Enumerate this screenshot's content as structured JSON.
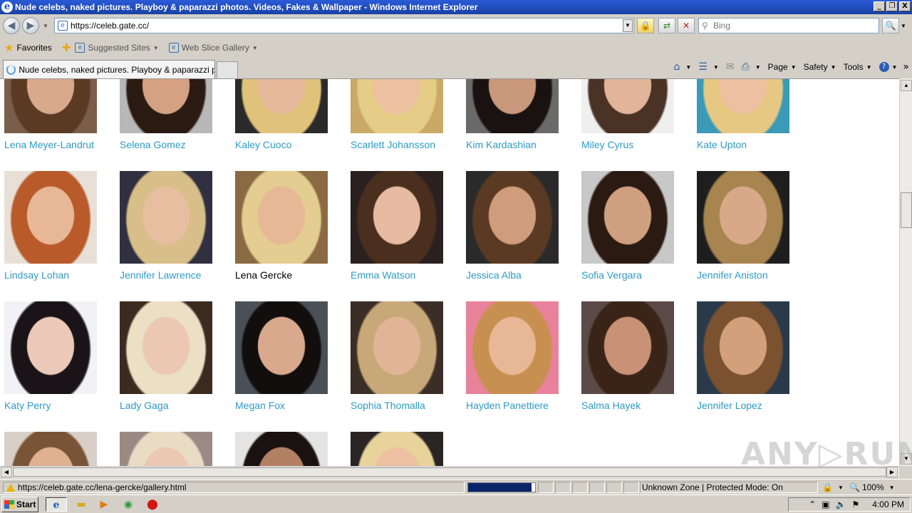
{
  "window": {
    "title": "Nude celebs, naked pictures. Playboy & paparazzi photos. Videos, Fakes & Wallpaper - Windows Internet Explorer",
    "minimize_glyph": "_",
    "restore_glyph": "❐",
    "close_glyph": "X"
  },
  "address_bar": {
    "url": "https://celeb.gate.cc/"
  },
  "search": {
    "placeholder": "Bing"
  },
  "favorites_bar": {
    "favorites_label": "Favorites",
    "suggested_sites_label": "Suggested Sites",
    "web_slice_gallery_label": "Web Slice Gallery"
  },
  "tab": {
    "label": "Nude celebs, naked pictures. Playboy & paparazzi ph..."
  },
  "command_bar": {
    "page_label": "Page",
    "safety_label": "Safety",
    "tools_label": "Tools"
  },
  "celebs": [
    {
      "name": "Lena Meyer-Landrut",
      "hair": "#5a3a22",
      "bg": "#7b5e4a",
      "skin": "#d9a98e"
    },
    {
      "name": "Selena Gomez",
      "hair": "#2a1a12",
      "bg": "#b8b8b8",
      "skin": "#d4a182"
    },
    {
      "name": "Kaley Cuoco",
      "hair": "#e0c27a",
      "bg": "#2a2a2a",
      "skin": "#e6b89c"
    },
    {
      "name": "Scarlett Johansson",
      "hair": "#e5cd88",
      "bg": "#c9a965",
      "skin": "#ecc0a0"
    },
    {
      "name": "Kim Kardashian",
      "hair": "#1a1210",
      "bg": "#6a6a6a",
      "skin": "#c9977b"
    },
    {
      "name": "Miley Cyrus",
      "hair": "#4a3224",
      "bg": "#efefef",
      "skin": "#e2b59b"
    },
    {
      "name": "Kate Upton",
      "hair": "#e7c882",
      "bg": "#3a9ab7",
      "skin": "#ecc0a0"
    },
    {
      "name": "Lindsay Lohan",
      "hair": "#b85a2a",
      "bg": "#e8e0d6",
      "skin": "#e8b796"
    },
    {
      "name": "Jennifer Lawrence",
      "hair": "#d8be88",
      "bg": "#303040",
      "skin": "#e8bea0"
    },
    {
      "name": "Lena Gercke",
      "hair": "#e4cd90",
      "bg": "#8a6a42",
      "skin": "#e6b896"
    },
    {
      "name": "Emma Watson",
      "hair": "#4a2e1e",
      "bg": "#2a2020",
      "skin": "#e6bba2"
    },
    {
      "name": "Jessica Alba",
      "hair": "#5a3a22",
      "bg": "#2a2a2a",
      "skin": "#cf9d7c"
    },
    {
      "name": "Sofia Vergara",
      "hair": "#2a1a12",
      "bg": "#c8c8c8",
      "skin": "#cf9f80"
    },
    {
      "name": "Jennifer Aniston",
      "hair": "#a8844e",
      "bg": "#1e1e1e",
      "skin": "#d9a889"
    },
    {
      "name": "Katy Perry",
      "hair": "#1a1418",
      "bg": "#f2f2f6",
      "skin": "#ecc9b8"
    },
    {
      "name": "Lady Gaga",
      "hair": "#ece0c4",
      "bg": "#3a2a20",
      "skin": "#ecc8b2"
    },
    {
      "name": "Megan Fox",
      "hair": "#120e0e",
      "bg": "#4a5058",
      "skin": "#d9a98e"
    },
    {
      "name": "Sophia Thomalla",
      "hair": "#c8a878",
      "bg": "#3a2e26",
      "skin": "#e2b497"
    },
    {
      "name": "Hayden Panettiere",
      "hair": "#c89050",
      "bg": "#e8829a",
      "skin": "#e8b796"
    },
    {
      "name": "Salma Hayek",
      "hair": "#3a2418",
      "bg": "#5a4a48",
      "skin": "#c99176"
    },
    {
      "name": "Jennifer Lopez",
      "hair": "#7a5230",
      "bg": "#2a3a4a",
      "skin": "#d3a07c"
    },
    {
      "name": "",
      "hair": "#7a5436",
      "bg": "#d8d0c8",
      "skin": "#e0b090"
    },
    {
      "name": "",
      "hair": "#e8dcc4",
      "bg": "#9a8a84",
      "skin": "#ecc8b2"
    },
    {
      "name": "",
      "hair": "#1a1210",
      "bg": "#e4e4e4",
      "skin": "#b48064"
    },
    {
      "name": "",
      "hair": "#e8d49a",
      "bg": "#2a2424",
      "skin": "#ecc0a0"
    }
  ],
  "hovered_celeb_index": 9,
  "statusbar": {
    "url": "https://celeb.gate.cc/lena-gercke/gallery.html",
    "zone": "Unknown Zone | Protected Mode: On",
    "zoom": "100%",
    "progress": 0.95
  },
  "taskbar": {
    "start_label": "Start",
    "clock": "4:00 PM"
  },
  "watermark": "ANY▷RUN"
}
